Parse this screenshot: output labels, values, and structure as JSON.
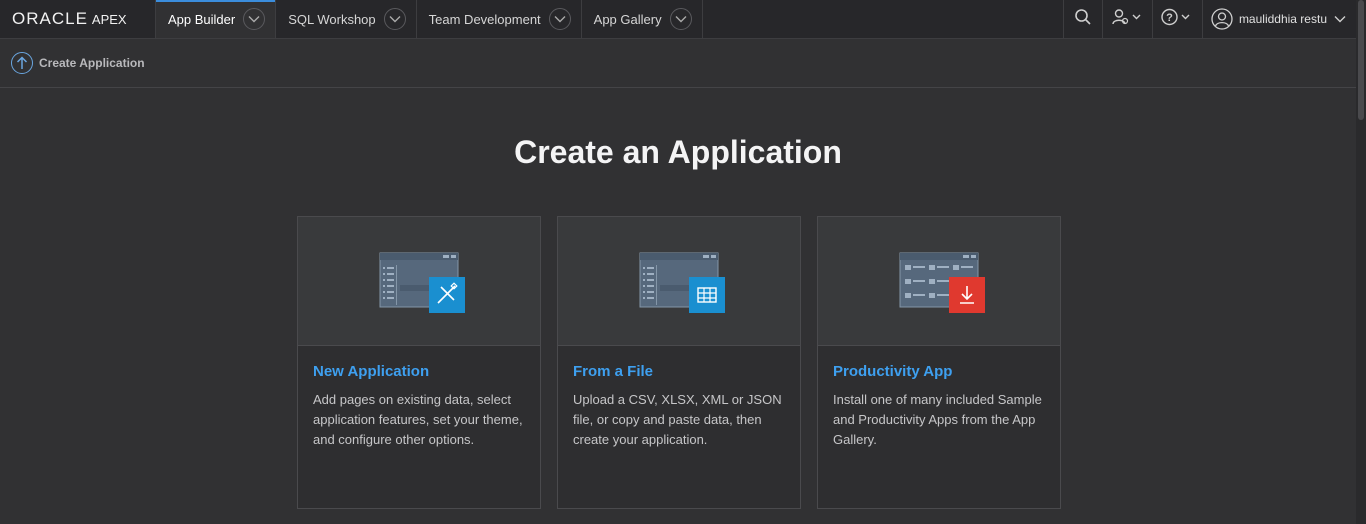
{
  "brand": {
    "oracle": "ORACLE",
    "apex": "APEX"
  },
  "tabs": [
    {
      "label": "App Builder",
      "active": true
    },
    {
      "label": "SQL Workshop"
    },
    {
      "label": "Team Development"
    },
    {
      "label": "App Gallery"
    }
  ],
  "user": {
    "name": "mauliddhia restu"
  },
  "icons": {
    "search": "search-icon",
    "admin": "user-admin-icon",
    "help": "help-icon",
    "avatar": "user-avatar-icon",
    "up": "arrow-up-icon"
  },
  "breadcrumb": {
    "label": "Create Application"
  },
  "page": {
    "title": "Create an Application"
  },
  "cards": [
    {
      "title": "New Application",
      "description": "Add pages on existing data, select application features, set your theme, and configure other options.",
      "badge_color": "#1a8fd0",
      "badge_icon": "pencil-ruler-icon"
    },
    {
      "title": "From a File",
      "description": "Upload a CSV, XLSX, XML or JSON file, or copy and paste data, then create your application.",
      "badge_color": "#1a8fd0",
      "badge_icon": "table-icon"
    },
    {
      "title": "Productivity App",
      "description": "Install one of many included Sample and Productivity Apps from the App Gallery.",
      "badge_color": "#e0392f",
      "badge_icon": "download-icon"
    }
  ],
  "colors": {
    "accent": "#3b8ddc",
    "link": "#3ea0f0",
    "background": "#313133"
  }
}
